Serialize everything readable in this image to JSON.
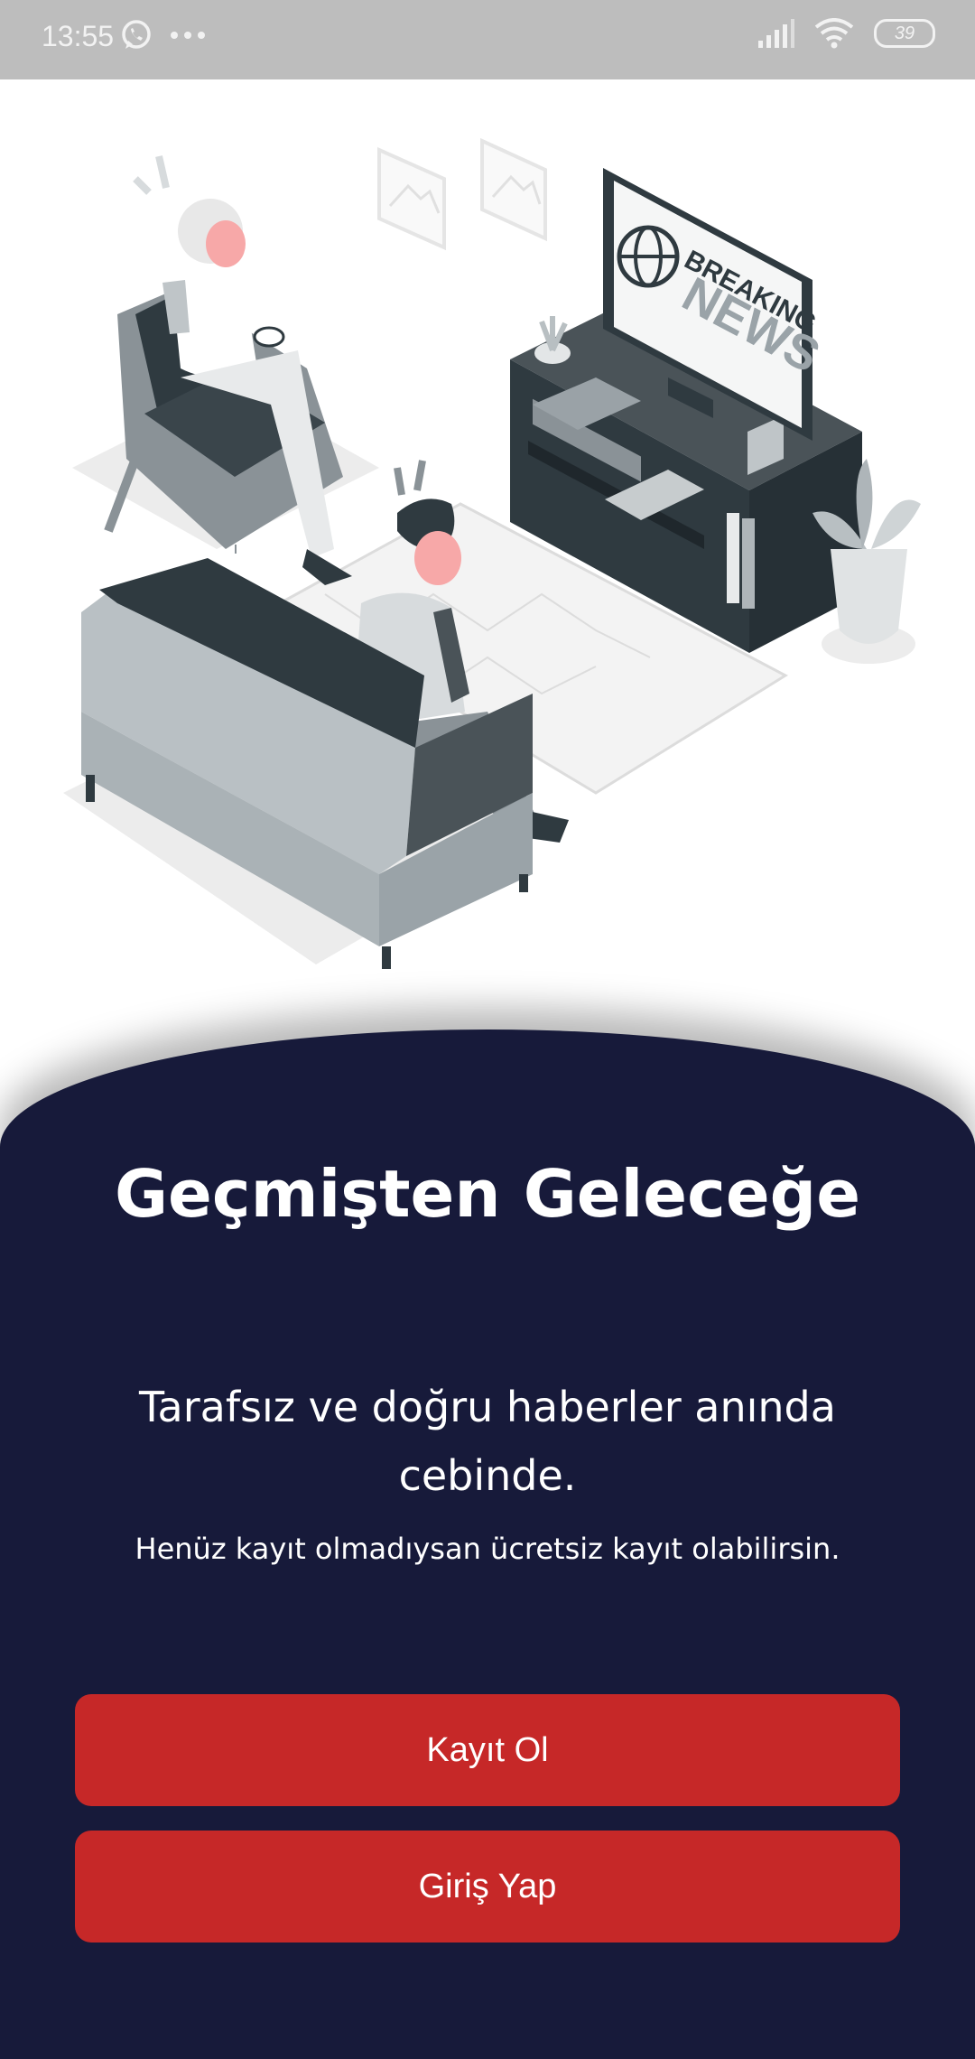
{
  "status_bar": {
    "time": "13:55",
    "battery": "39",
    "icons": [
      "whatsapp-icon",
      "more-dots-icon",
      "signal-icon",
      "wifi-icon",
      "battery-icon"
    ]
  },
  "illustration": {
    "tv_line1": "BREAKING",
    "tv_line2": "NEWS"
  },
  "onboarding": {
    "title": "Geçmişten Geleceğe",
    "subtitle": "Tarafsız ve doğru haberler anında cebinde.",
    "hint": "Henüz kayıt olmadıysan ücretsiz kayıt olabilirsin."
  },
  "buttons": {
    "register_label": "Kayıt Ol",
    "login_label": "Giriş Yap"
  },
  "colors": {
    "status_bar_bg": "#bdbdbd",
    "panel_bg": "#171a3a",
    "button_bg": "#c62828",
    "text": "#ffffff"
  }
}
